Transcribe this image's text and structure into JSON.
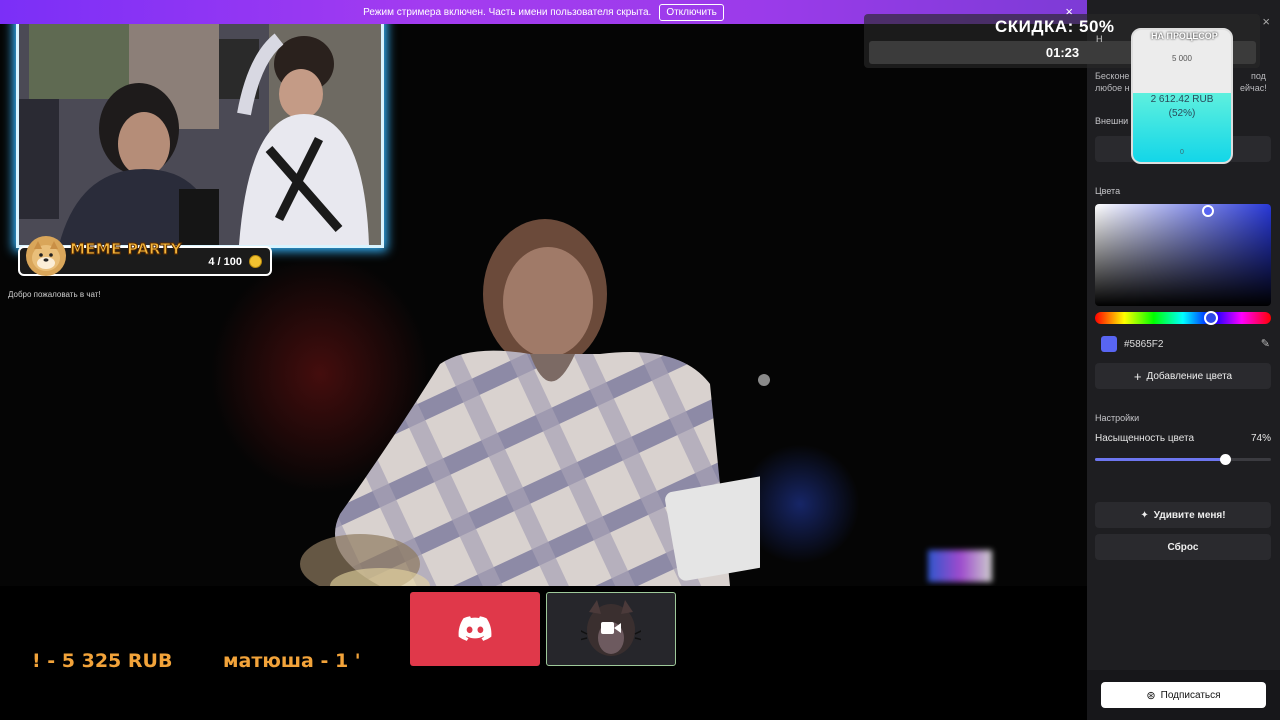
{
  "banner": {
    "text": "Режим стримера включен. Часть имени пользователя скрыта.",
    "button_label": "Отключить",
    "close_icon": "×"
  },
  "overlay": {
    "meme_party_title": "MEME PARTY",
    "meme_party_count": "4 / 100",
    "welcome_text": "Добро пожаловать в чат!",
    "discount_label": "СКИДКА: 50%",
    "timer": "01:23"
  },
  "goal_widget": {
    "title": "НА ПРОЦЕСОР",
    "target": "5 000",
    "amount": "2 612.42 RUB",
    "percent_text": "(52%)",
    "progress": 0.52,
    "min_label": "0",
    "hidden_title_fragment": "Н"
  },
  "panel": {
    "close_icon": "×",
    "desc_line1": "Бесконе",
    "desc_line1_end": "под",
    "desc_line2": "любое н",
    "desc_line2_end": "ейчас!",
    "external_label": "Внешни",
    "colors_label": "Цвета",
    "hex_value": "#5865F2",
    "accent_color": "#5865F2",
    "add_color_label": "Добавление цвета",
    "settings_label": "Настройки",
    "saturation_label": "Насыщенность цвета",
    "saturation_value": "74%",
    "saturation": 0.74,
    "surprise_label": "Удивите меня!",
    "reset_label": "Сброс",
    "subscribe_label": "Подписаться"
  },
  "bottom": {
    "ticker_1": "! - 5 325 RUB",
    "ticker_2": "матюша - 1 '"
  }
}
